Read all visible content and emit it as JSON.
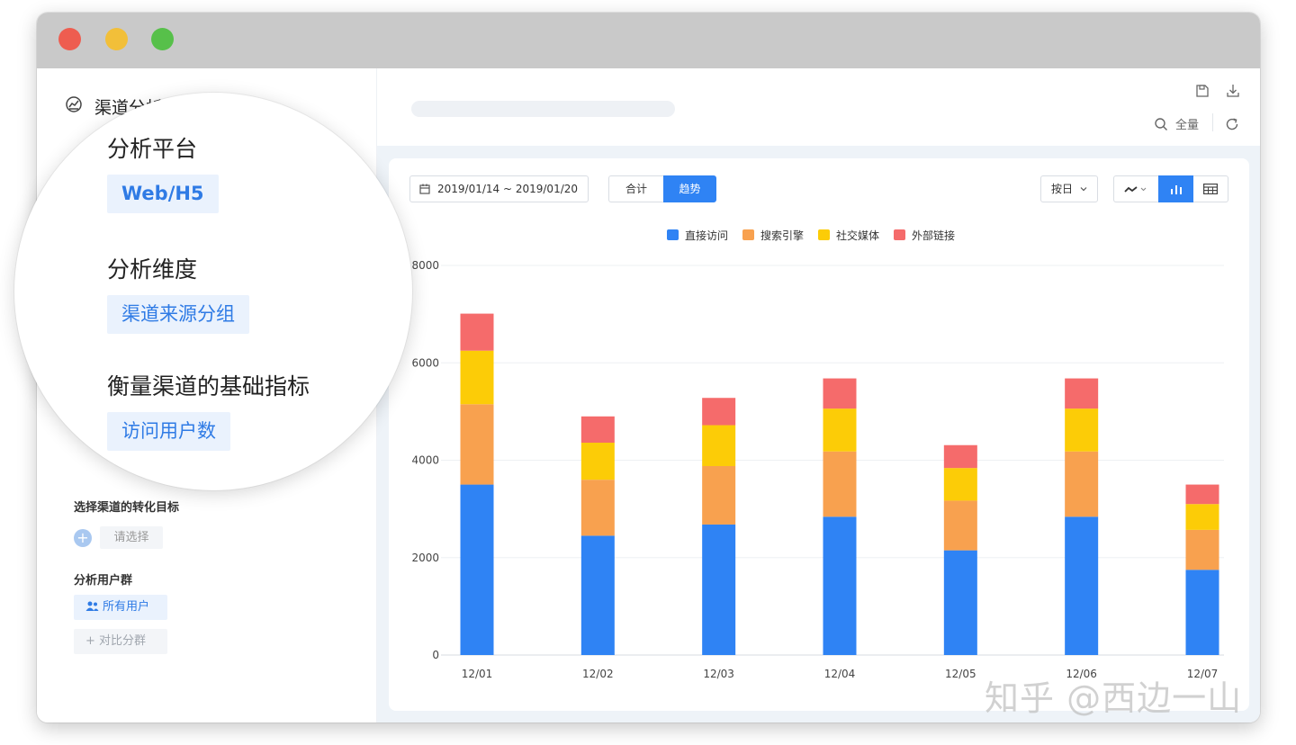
{
  "sidebar": {
    "title": "渠道分析",
    "conversion_label": "选择渠道的转化目标",
    "select_placeholder": "请选择",
    "user_group_label": "分析用户群",
    "all_users": "所有用户",
    "compare_groups": "+ 对比分群"
  },
  "magnifier": {
    "platform_heading": "分析平台",
    "platform_value": "Web/H5",
    "dimension_heading": "分析维度",
    "dimension_value": "渠道来源分组",
    "metric_heading": "衡量渠道的基础指标",
    "metric_value": "访问用户数"
  },
  "topbar": {
    "scope_label": "全量"
  },
  "toolbar": {
    "date_range": "2019/01/14 ~ 2019/01/20",
    "total_label": "合计",
    "trend_label": "趋势",
    "granularity": "按日"
  },
  "icons": {
    "title": "dashboard-icon",
    "save": "save-icon",
    "download": "download-icon",
    "search": "search-icon",
    "refresh": "refresh-icon",
    "calendar": "calendar-icon",
    "line_chart": "line-chart-icon",
    "bar_chart": "bar-chart-icon",
    "table": "table-icon",
    "users": "users-icon"
  },
  "watermark": "知乎 @西边一山",
  "colors": {
    "accent": "#2f83f4",
    "series": [
      "#2f83f4",
      "#f8a14f",
      "#fccc07",
      "#f56b6b"
    ]
  },
  "chart_data": {
    "type": "bar",
    "stacked": true,
    "categories": [
      "12/01",
      "12/02",
      "12/03",
      "12/04",
      "12/05",
      "12/06",
      "12/07"
    ],
    "series": [
      {
        "name": "直接访问",
        "values": [
          3500,
          2450,
          2680,
          2840,
          2150,
          2840,
          1750
        ]
      },
      {
        "name": "搜索引擎",
        "values": [
          1650,
          1150,
          1200,
          1340,
          1020,
          1340,
          820
        ]
      },
      {
        "name": "社交媒体",
        "values": [
          1100,
          760,
          840,
          880,
          670,
          880,
          530
        ]
      },
      {
        "name": "外部链接",
        "values": [
          760,
          540,
          560,
          620,
          470,
          620,
          400
        ]
      }
    ],
    "ylim": [
      0,
      8000
    ],
    "yticks": [
      0,
      2000,
      4000,
      6000,
      8000
    ],
    "grid": true,
    "legend": "top-center"
  }
}
